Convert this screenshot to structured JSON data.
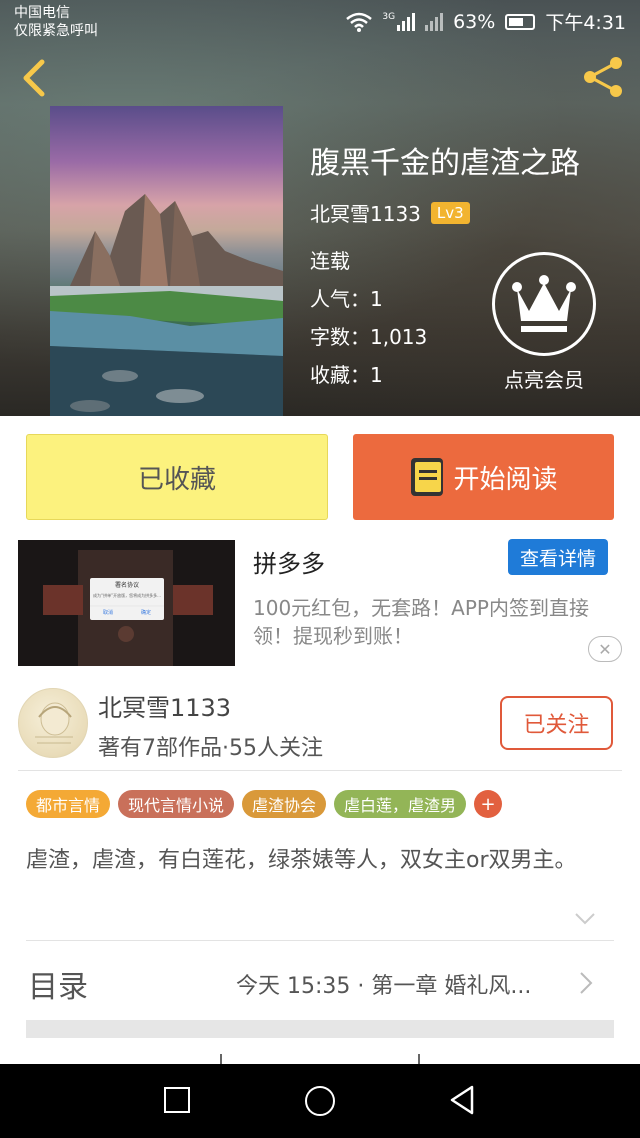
{
  "status_bar": {
    "carrier": "中国电信",
    "carrier_note": "仅限紧急呼叫",
    "network": "3G",
    "battery": "63%",
    "time": "下午4:31"
  },
  "header": {
    "back_icon": "back-chevron-icon",
    "share_icon": "share-icon"
  },
  "book": {
    "title": "腹黑千金的虐渣之路",
    "author": "北冥雪1133",
    "level": "Lv3",
    "status": "连载",
    "popularity": "人气：1",
    "word_count": "字数：1,013",
    "favorites": "收藏：1",
    "vip_label": "点亮会员"
  },
  "actions": {
    "favorite_label": "已收藏",
    "read_label": "开始阅读"
  },
  "ad": {
    "title": "拼多多",
    "button": "查看详情",
    "text": "100元红包，无套路！APP内签到直接领！提现秒到账！",
    "image_dialog_title": "署名协议",
    "image_dialog_body": "成为“拼单”开放版，您将成为拼多多...",
    "image_dialog_cancel": "取消",
    "image_dialog_ok": "确定",
    "close_icon": "close-icon"
  },
  "author_card": {
    "name": "北冥雪1133",
    "stats": "著有7部作品·55人关注",
    "follow_label": "已关注"
  },
  "tags": [
    {
      "label": "都市言情",
      "color": "#f4a935"
    },
    {
      "label": "现代言情小说",
      "color": "#c9705a"
    },
    {
      "label": "虐渣协会",
      "color": "#d9993a"
    },
    {
      "label": "虐白莲，虐渣男",
      "color": "#93b557"
    }
  ],
  "tag_plus": "+",
  "description": "虐渣，虐渣，有白莲花，绿茶婊等人，双女主or双男主。",
  "toc": {
    "label": "目录",
    "latest": "今天 15:35 · 第一章 婚礼风..."
  },
  "colors": {
    "accent_orange": "#ec6a3e",
    "favorite_yellow": "#fcf27e",
    "ad_blue": "#1f7bd8",
    "level_gold": "#f2b430"
  }
}
